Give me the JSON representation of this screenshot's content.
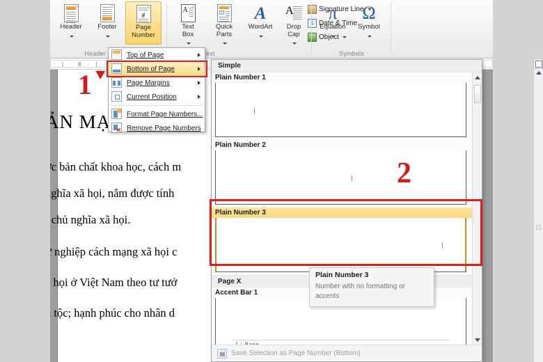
{
  "ribbon": {
    "groups": [
      {
        "label": "Header & Footer"
      },
      {
        "label": "Text"
      },
      {
        "label": "Symbols"
      }
    ],
    "big_buttons": [
      {
        "name": "header",
        "label": "Header",
        "has_caret": true,
        "selected": false
      },
      {
        "name": "footer",
        "label": "Footer",
        "has_caret": true,
        "selected": false
      },
      {
        "name": "page-number",
        "label": "Page\nNumber",
        "has_caret": true,
        "selected": true
      },
      {
        "name": "text-box",
        "label": "Text\nBox",
        "has_caret": true,
        "selected": false
      },
      {
        "name": "quick-parts",
        "label": "Quick\nParts",
        "has_caret": true,
        "selected": false
      },
      {
        "name": "wordart",
        "label": "WordArt",
        "has_caret": true,
        "selected": false
      },
      {
        "name": "drop-cap",
        "label": "Drop\nCap",
        "has_caret": true,
        "selected": false
      },
      {
        "name": "equation",
        "label": "Equation",
        "glyph": "π",
        "has_caret": true,
        "selected": false
      },
      {
        "name": "symbol",
        "label": "Symbol",
        "glyph": "Ω",
        "has_caret": true,
        "selected": false
      }
    ],
    "small_buttons": [
      {
        "name": "signature-line",
        "label": "Signature Line",
        "has_caret": true
      },
      {
        "name": "date-and-time",
        "label": "Date & Time",
        "has_caret": false
      },
      {
        "name": "object",
        "label": "Object",
        "has_caret": true
      }
    ]
  },
  "ruler": {
    "ticks": "·  |  ·  8  ·  |  ·"
  },
  "page_number_menu": {
    "items": [
      {
        "label": "Top of Page",
        "mnemonic": "T",
        "submenu": true,
        "highlighted": false
      },
      {
        "label": "Bottom of Page",
        "mnemonic": "B",
        "submenu": true,
        "highlighted": true
      },
      {
        "label": "Page Margins",
        "mnemonic": "P",
        "submenu": true,
        "highlighted": false
      },
      {
        "label": "Current Position",
        "mnemonic": "C",
        "submenu": true,
        "highlighted": false
      },
      {
        "label": "Format Page Numbers...",
        "mnemonic": "F",
        "submenu": false,
        "highlighted": false
      },
      {
        "label": "Remove Page Numbers",
        "mnemonic": "R",
        "submenu": false,
        "highlighted": false
      }
    ]
  },
  "gallery": {
    "header": "Simple",
    "entries": [
      {
        "kind": "item",
        "label": "Plain Number 1",
        "highlighted": false,
        "align": "left"
      },
      {
        "kind": "item",
        "label": "Plain Number 2",
        "highlighted": false,
        "align": "center"
      },
      {
        "kind": "item",
        "label": "Plain Number 3",
        "highlighted": true,
        "align": "right"
      },
      {
        "kind": "group",
        "label": "Page X"
      },
      {
        "kind": "item",
        "label": "Accent Bar 1",
        "highlighted": false,
        "align": "accent"
      }
    ],
    "preview_page_label": "1 | Page",
    "footer_label": "Save Selection as Page Number (Bottom)",
    "footer_mnemonic": "S"
  },
  "tooltip": {
    "title": "Plain Number 3",
    "body": "Number with no formatting or accents"
  },
  "document": {
    "heading": "ẢN MẠO ĐẦU",
    "lines": [
      "ợc bản chất khoa học, cách m",
      "nghĩa xã họi, nắm được tính",
      "i chủ nghĩa xã họi.",
      "ự nghiệp cách mạng xã họi c",
      "ã họi ở Việt Nam theo tư tưở",
      "n tộc; hạnh phúc cho nhân d"
    ]
  },
  "annotations": {
    "marker_1": "1",
    "marker_2": "2"
  },
  "colors": {
    "accent_red": "#e21b1b",
    "marker_red": "#cf1b1b",
    "highlight_yellow": "#fbd87f",
    "ribbon_selected": "#f8d36b"
  }
}
